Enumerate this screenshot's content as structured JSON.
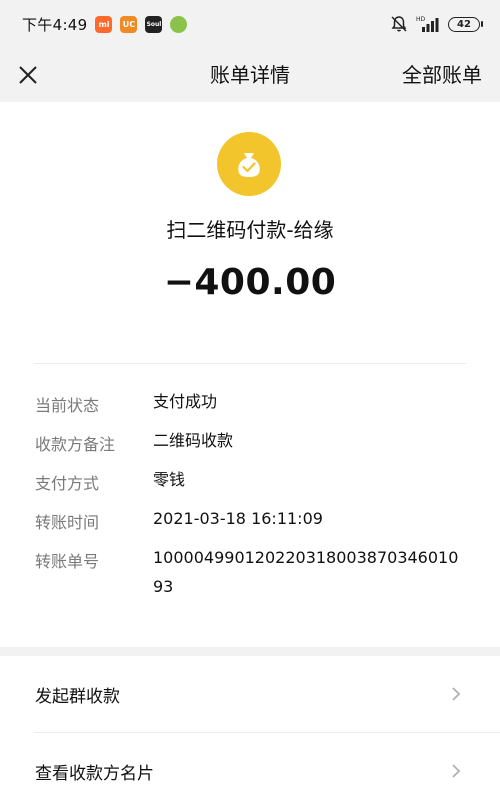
{
  "status_bar": {
    "time": "下午4:49",
    "apps": [
      {
        "icon": "mi-app-icon",
        "label": "mi",
        "color": "#ff6a2c"
      },
      {
        "icon": "uc-app-icon",
        "label": "UC",
        "color": "#f08a24"
      },
      {
        "icon": "soul-app-icon",
        "label": "Soul",
        "color": "#222222"
      },
      {
        "icon": "ball-app-icon",
        "label": "",
        "color": "#8bc34a"
      }
    ],
    "battery_level": "42",
    "icons": [
      "mute-bell-icon",
      "hd-signal-icon",
      "battery-icon"
    ]
  },
  "nav": {
    "close_icon": "close-icon",
    "title": "账单详情",
    "action": "全部账单"
  },
  "bill": {
    "icon": "money-bag-icon",
    "icon_color": "#f2c52d",
    "payee": "扫二维码付款-给缘",
    "amount": "−400.00"
  },
  "details": [
    {
      "label": "当前状态",
      "value": "支付成功"
    },
    {
      "label": "收款方备注",
      "value": "二维码收款"
    },
    {
      "label": "支付方式",
      "value": "零钱"
    },
    {
      "label": "转账时间",
      "value": "2021-03-18 16:11:09"
    },
    {
      "label": "转账单号",
      "value": "100004990120220318003870346010 93"
    }
  ],
  "actions": [
    {
      "label": "发起群收款",
      "icon": "chevron-right-icon"
    },
    {
      "label": "查看收款方名片",
      "icon": "chevron-right-icon"
    }
  ]
}
